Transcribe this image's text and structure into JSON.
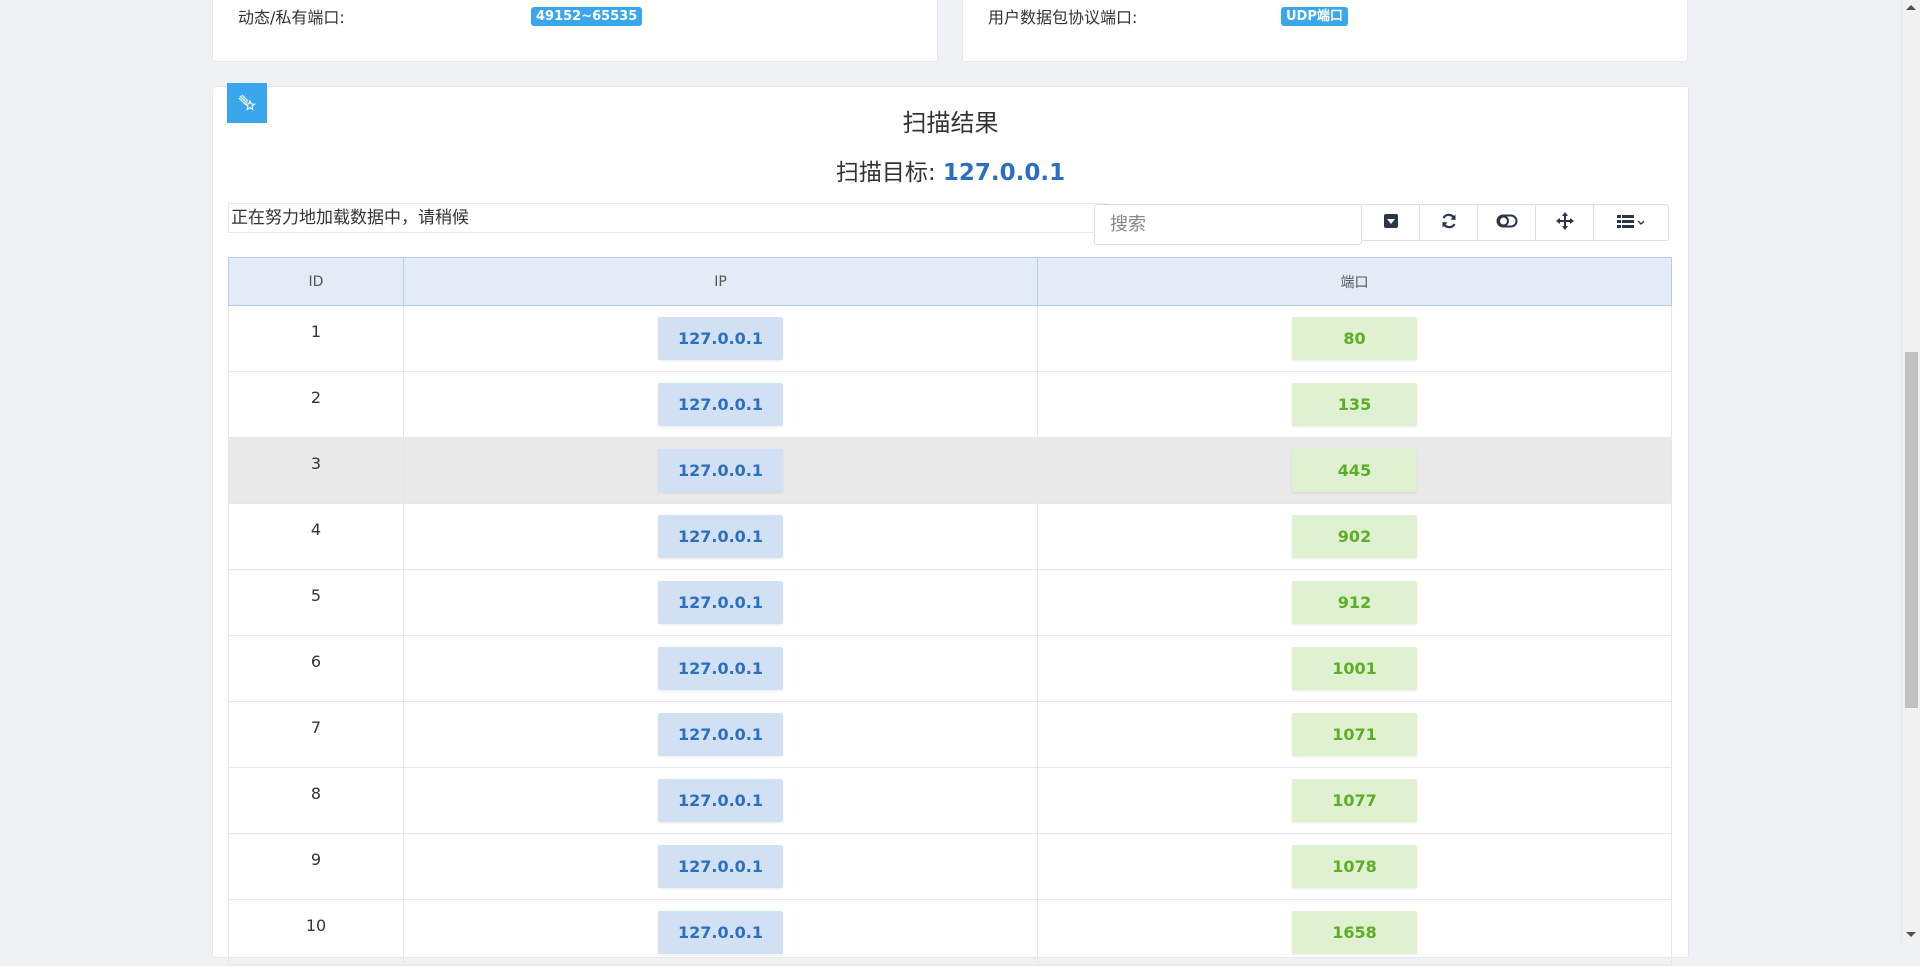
{
  "top_cards": {
    "left": {
      "label": "动态/私有端口:",
      "badge": "49152~65535"
    },
    "right": {
      "label": "用户数据包协议端口:",
      "badge": "UDP端口"
    }
  },
  "panel": {
    "badge_icon": "shooting-star-icon",
    "title": "扫描结果",
    "target_label": "扫描目标:",
    "target_value": "127.0.0.1"
  },
  "toolbar": {
    "loading_text": "正在努力地加载数据中，请稍候",
    "search_placeholder": "搜索",
    "buttons": [
      {
        "name": "export-dropdown-icon"
      },
      {
        "name": "refresh-icon"
      },
      {
        "name": "toggle-icon"
      },
      {
        "name": "move-icon"
      },
      {
        "name": "columns-list-icon"
      }
    ]
  },
  "table": {
    "headers": {
      "id": "ID",
      "ip": "IP",
      "port": "端口"
    },
    "rows": [
      {
        "id": "1",
        "ip": "127.0.0.1",
        "port": "80"
      },
      {
        "id": "2",
        "ip": "127.0.0.1",
        "port": "135"
      },
      {
        "id": "3",
        "ip": "127.0.0.1",
        "port": "445"
      },
      {
        "id": "4",
        "ip": "127.0.0.1",
        "port": "902"
      },
      {
        "id": "5",
        "ip": "127.0.0.1",
        "port": "912"
      },
      {
        "id": "6",
        "ip": "127.0.0.1",
        "port": "1001"
      },
      {
        "id": "7",
        "ip": "127.0.0.1",
        "port": "1071"
      },
      {
        "id": "8",
        "ip": "127.0.0.1",
        "port": "1077"
      },
      {
        "id": "9",
        "ip": "127.0.0.1",
        "port": "1078"
      },
      {
        "id": "10",
        "ip": "127.0.0.1",
        "port": "1658"
      }
    ],
    "highlighted_row": 3
  },
  "colors": {
    "accent_blue": "#3aa7ec",
    "ip_text": "#2c6fc2",
    "ip_bg": "#d1e1f3",
    "port_text": "#5cae26",
    "port_bg": "#dff1d0"
  }
}
